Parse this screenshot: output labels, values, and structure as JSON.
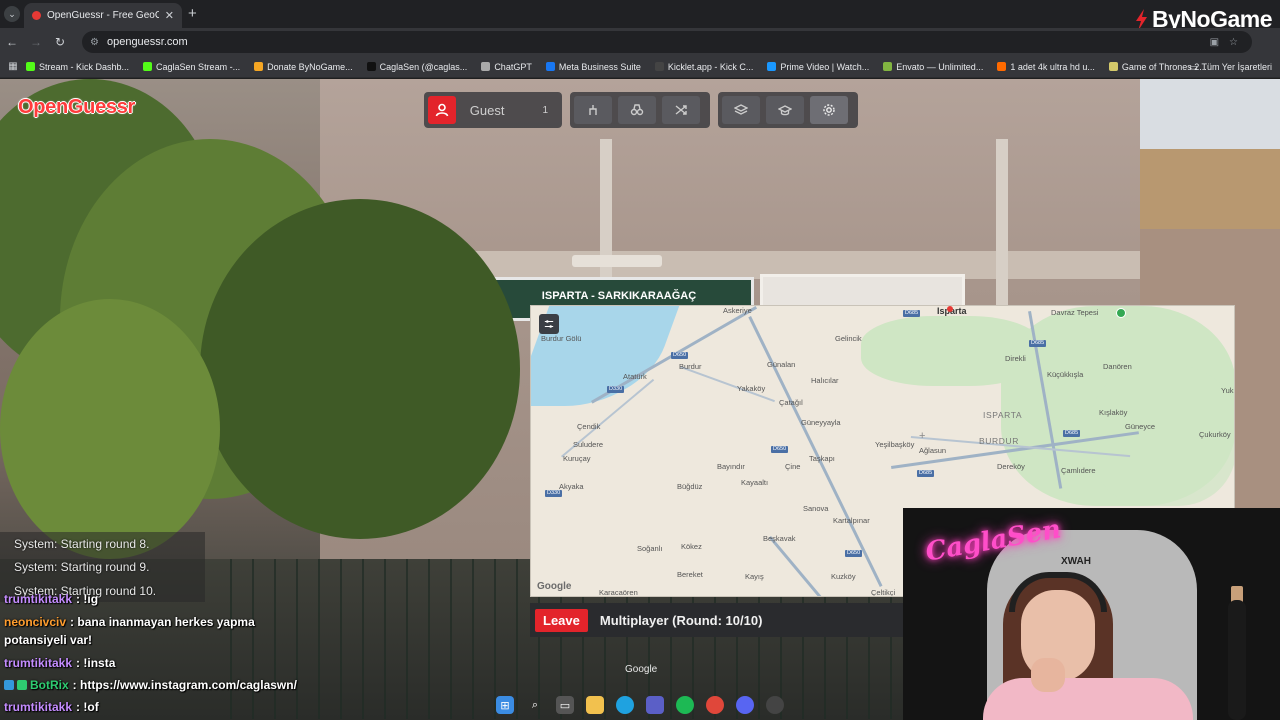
{
  "browser": {
    "tab_title": "OpenGuessr - Free GeoGuessr A",
    "url": "openguessr.com",
    "brand": "ByNoGame",
    "bookmarks": [
      {
        "label": "Stream - Kick Dashb...",
        "color": "#53fc18"
      },
      {
        "label": "CaglaSen Stream -...",
        "color": "#53fc18"
      },
      {
        "label": "Donate ByNoGame...",
        "color": "#f5a623"
      },
      {
        "label": "CaglaSen (@caglas...",
        "color": "#111111"
      },
      {
        "label": "ChatGPT",
        "color": "#aaaaaa"
      },
      {
        "label": "Meta Business Suite",
        "color": "#1877f2"
      },
      {
        "label": "Kicklet.app - Kick C...",
        "color": "#444444"
      },
      {
        "label": "Prime Video | Watch...",
        "color": "#1a98ff"
      },
      {
        "label": "Envato — Unlimited...",
        "color": "#82b541"
      },
      {
        "label": "1 adet 4k ultra hd u...",
        "color": "#ff6a00"
      },
      {
        "label": "Game of Thrones 2...",
        "color": "#d4c96a"
      }
    ],
    "all_bookmarks": "Tüm Yer İşaretleri"
  },
  "game": {
    "logo": "OpenGuessr",
    "guest_label": "Guest",
    "guest_count": "1",
    "sign_text": "ISPARTA - SARKIKARAAĞAÇ",
    "leave_label": "Leave",
    "round_text": "Multiplayer (Round: 10/10)",
    "google_label": "Google"
  },
  "map": {
    "attribution": "Google",
    "places": [
      {
        "name": "Isparta",
        "kind": "city"
      },
      {
        "name": "Davraz Tepesi",
        "kind": "place"
      },
      {
        "name": "Askeriye",
        "kind": "place"
      },
      {
        "name": "Gelincik",
        "kind": "place"
      },
      {
        "name": "Burdur Gölü",
        "kind": "place"
      },
      {
        "name": "Burdur",
        "kind": "place"
      },
      {
        "name": "Atatürk",
        "kind": "place"
      },
      {
        "name": "Günalan",
        "kind": "place"
      },
      {
        "name": "Halıcılar",
        "kind": "place"
      },
      {
        "name": "Yakaköy",
        "kind": "place"
      },
      {
        "name": "Direkli",
        "kind": "place"
      },
      {
        "name": "Danören",
        "kind": "place"
      },
      {
        "name": "Küçükkışla",
        "kind": "place"
      },
      {
        "name": "Çatağıl",
        "kind": "place"
      },
      {
        "name": "ISPARTA",
        "kind": "region"
      },
      {
        "name": "BURDUR",
        "kind": "region"
      },
      {
        "name": "Kışlaköy",
        "kind": "place"
      },
      {
        "name": "Güneyce",
        "kind": "place"
      },
      {
        "name": "Çukurköy",
        "kind": "place"
      },
      {
        "name": "Güneyyayla",
        "kind": "place"
      },
      {
        "name": "Çendik",
        "kind": "place"
      },
      {
        "name": "Suludere",
        "kind": "place"
      },
      {
        "name": "Kuruçay",
        "kind": "place"
      },
      {
        "name": "Yeşilbaşköy",
        "kind": "place"
      },
      {
        "name": "Ağlasun",
        "kind": "place"
      },
      {
        "name": "Dereköy",
        "kind": "place"
      },
      {
        "name": "Çamlıdere",
        "kind": "place"
      },
      {
        "name": "Bayındır",
        "kind": "place"
      },
      {
        "name": "Çine",
        "kind": "place"
      },
      {
        "name": "Taşkapı",
        "kind": "place"
      },
      {
        "name": "Akyaka",
        "kind": "place"
      },
      {
        "name": "Büğdüz",
        "kind": "place"
      },
      {
        "name": "Kayaaltı",
        "kind": "place"
      },
      {
        "name": "Sanova",
        "kind": "place"
      },
      {
        "name": "Kartalpınar",
        "kind": "place"
      },
      {
        "name": "Beşkavak",
        "kind": "place"
      },
      {
        "name": "Soğanlı",
        "kind": "place"
      },
      {
        "name": "Kökez",
        "kind": "place"
      },
      {
        "name": "Bereket",
        "kind": "place"
      },
      {
        "name": "Kayış",
        "kind": "place"
      },
      {
        "name": "Kuzköy",
        "kind": "place"
      },
      {
        "name": "Karacaören",
        "kind": "place"
      },
      {
        "name": "Çeltikçi",
        "kind": "place"
      },
      {
        "name": "Yuk",
        "kind": "place"
      }
    ],
    "shields": [
      "D650",
      "D330",
      "D650",
      "D330",
      "D685",
      "D685",
      "D685",
      "D650",
      "D685"
    ]
  },
  "system_messages": [
    "System: Starting round 8.",
    "System: Starting round 9.",
    "System: Starting round 10."
  ],
  "chat": [
    {
      "user": "trumtikitakk",
      "text": ": !ig",
      "color": "#c48cff"
    },
    {
      "user": "neoncivciv",
      "text": ": bana inanmayan herkes yapma",
      "color": "#ff9d2e"
    },
    {
      "user": "",
      "text": "potansiyeli var!",
      "color": "#ffffff"
    },
    {
      "user": "trumtikitakk",
      "text": ": !insta",
      "color": "#c48cff"
    },
    {
      "user": "BotRix",
      "text": ": https://www.instagram.com/caglaswn/",
      "color": "#2ecc71"
    },
    {
      "user": "trumtikitakk",
      "text": ": !of",
      "color": "#c48cff"
    }
  ],
  "webcam": {
    "neon_sign": "CaglaSen",
    "chair_text": "XWAH"
  },
  "colors": {
    "accent_red": "#e3242b",
    "map_water": "#a8d6ea",
    "map_green": "#cfe6c4"
  }
}
